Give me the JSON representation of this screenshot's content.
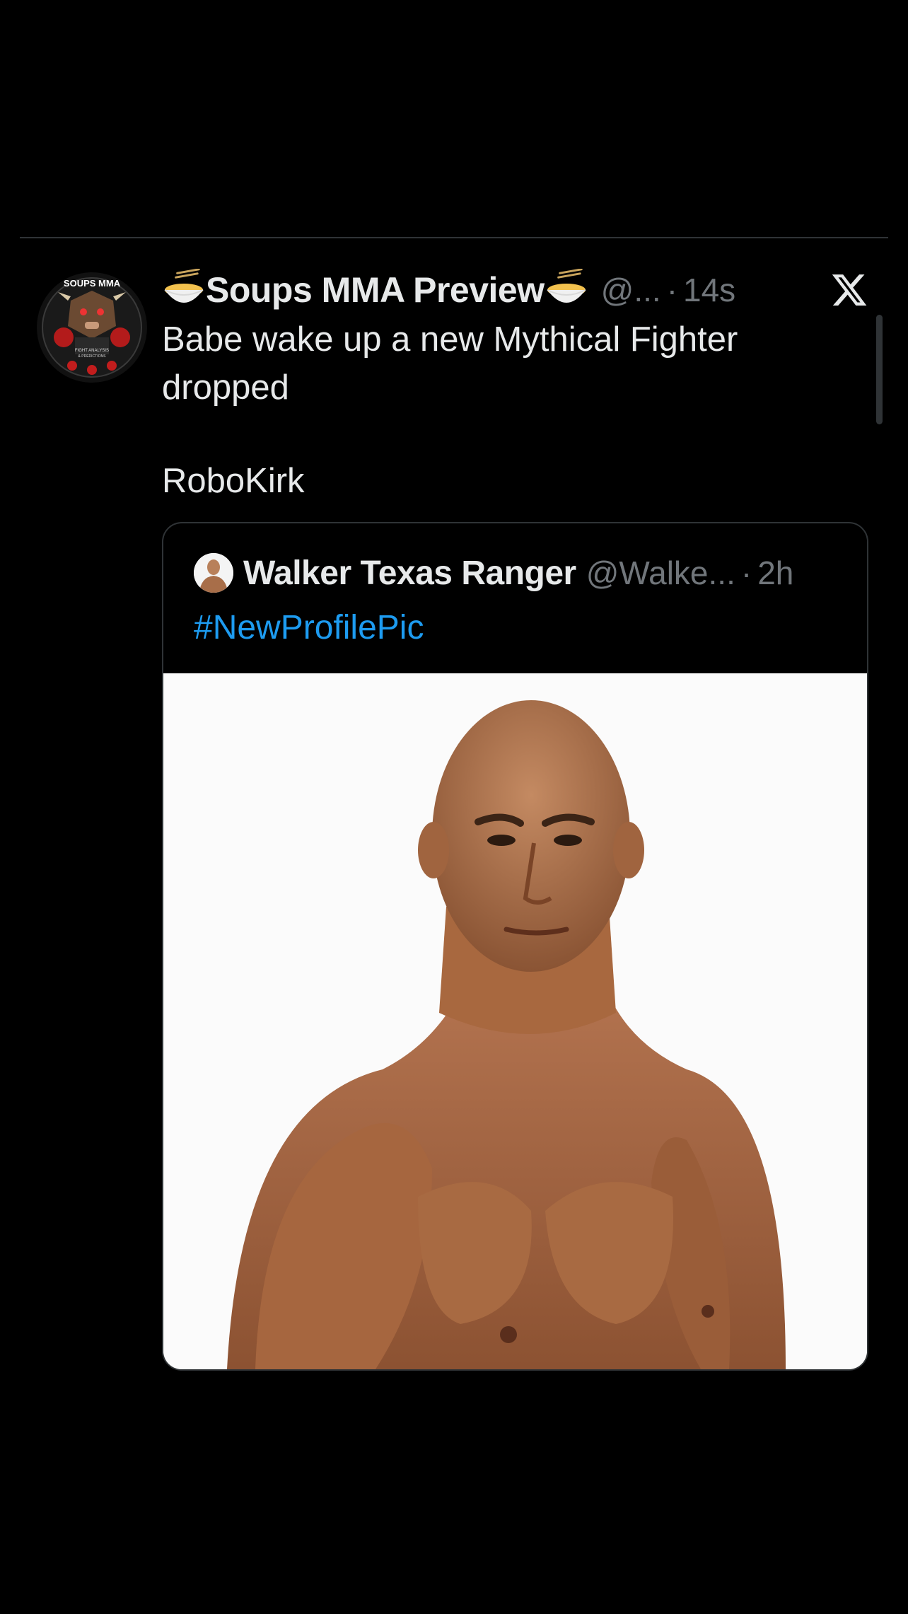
{
  "tweet": {
    "author": {
      "display_name": "Soups MMA Preview",
      "name_emoji": "ramen-bowl-emoji",
      "handle": "@...",
      "separator": "·",
      "time": "14s",
      "avatar_icon": "soups-mma-logo-avatar",
      "avatar_text_top": "SOUPS MMA",
      "avatar_text_bottom_1": "FIGHT ANALYSIS",
      "avatar_text_bottom_2": "& PREDICTIONS"
    },
    "text_line_1": "Babe wake up a new Mythical Fighter dropped",
    "text_line_2": "RoboKirk"
  },
  "quoted_tweet": {
    "display_name": "Walker Texas Ranger",
    "handle": "@Walke...",
    "separator": "·",
    "time": "2h",
    "hashtag": "#NewProfilePic",
    "avatar_icon": "fighter-portrait-avatar",
    "image_icon": "shirtless-bald-fighter-photo"
  },
  "platform_icon": "x-logo-icon",
  "colors": {
    "background": "#000000",
    "text_primary": "#e7e9ea",
    "text_secondary": "#71767b",
    "link": "#1d9bf0",
    "border": "#2f3336"
  }
}
